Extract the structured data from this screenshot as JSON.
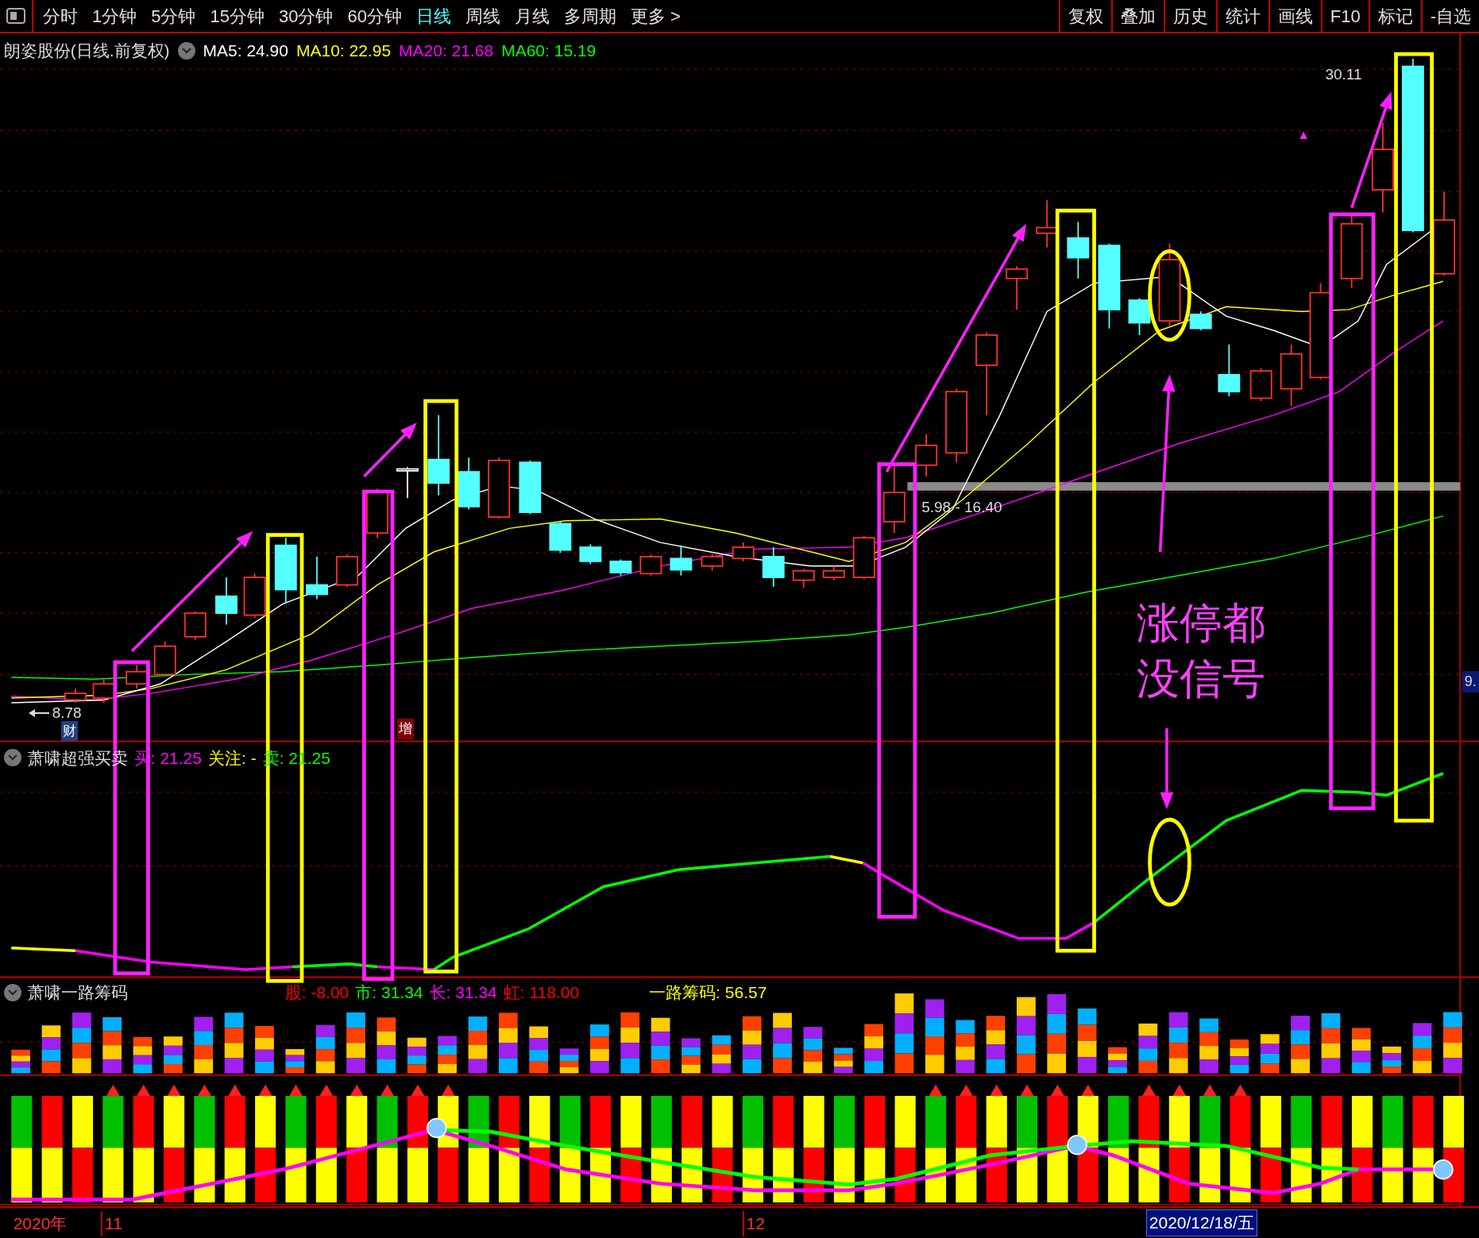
{
  "toolbar": {
    "periods": [
      {
        "label": "分时",
        "selected": false
      },
      {
        "label": "1分钟",
        "selected": false
      },
      {
        "label": "5分钟",
        "selected": false
      },
      {
        "label": "15分钟",
        "selected": false
      },
      {
        "label": "30分钟",
        "selected": false
      },
      {
        "label": "60分钟",
        "selected": false
      },
      {
        "label": "日线",
        "selected": true
      },
      {
        "label": "周线",
        "selected": false
      },
      {
        "label": "月线",
        "selected": false
      },
      {
        "label": "多周期",
        "selected": false
      },
      {
        "label": "更多 >",
        "selected": false
      }
    ],
    "tools": [
      "复权",
      "叠加",
      "历史",
      "统计",
      "画线",
      "F10",
      "标记",
      "-自选"
    ]
  },
  "main_panel": {
    "title": "朗姿股份(日线.前复权)",
    "indicators": [
      {
        "label": "MA5: 24.90",
        "color": "#ffffff"
      },
      {
        "label": "MA10: 22.95",
        "color": "#ffff00"
      },
      {
        "label": "MA20: 21.68",
        "color": "#ff00ff"
      },
      {
        "label": "MA60: 15.19",
        "color": "#00ff00"
      }
    ],
    "high_label": "30.11",
    "low_label": "8.78",
    "range_label": "5.98 - 16.40",
    "axis_label": "9.",
    "markers": [
      "财",
      "增"
    ],
    "annotation": [
      "涨停都",
      "没信号"
    ]
  },
  "panel_2": {
    "title": "萧啸超强买卖",
    "values": [
      {
        "label": "买: 21.25",
        "color": "#ff00ff"
      },
      {
        "label": "关注: -",
        "color": "#ffff00"
      },
      {
        "label": "卖: 21.25",
        "color": "#00ff00"
      }
    ]
  },
  "panel_3": {
    "title": "萧啸一路筹码",
    "values": [
      {
        "label": "股: -8.00",
        "color": "#ff0000"
      },
      {
        "label": "市: 31.34",
        "color": "#00ff00"
      },
      {
        "label": "长: 31.34",
        "color": "#ff00ff"
      },
      {
        "label": "虹: 118.00",
        "color": "#ff0000"
      },
      {
        "label": "一路筹码: 56.57",
        "color": "#ffff00"
      }
    ]
  },
  "time_axis": [
    {
      "label": "2020年",
      "kind": "year"
    },
    {
      "label": "11",
      "kind": "month"
    },
    {
      "label": "12",
      "kind": "month"
    },
    {
      "label": "2020/12/18/五",
      "kind": "cursor"
    }
  ]
}
